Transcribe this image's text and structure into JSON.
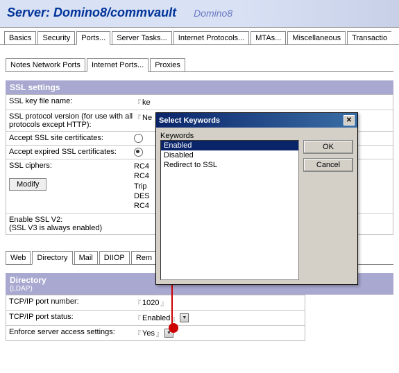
{
  "header": {
    "prefix": "Server: ",
    "title": "Domino8/commvault",
    "sub": "Domino8"
  },
  "tabs": [
    "Basics",
    "Security",
    "Ports...",
    "Server Tasks...",
    "Internet Protocols...",
    "MTAs...",
    "Miscellaneous",
    "Transactio"
  ],
  "subtabs": [
    "Notes Network Ports",
    "Internet Ports...",
    "Proxies"
  ],
  "ssl": {
    "title": "SSL settings",
    "key_label": "SSL key file name:",
    "key_value": "ke",
    "proto_label": "SSL protocol version (for use with all protocols except HTTP):",
    "proto_value": "Ne",
    "site_label": "Accept SSL site certificates:",
    "expired_label": "Accept expired SSL certificates:",
    "ciphers_label": "SSL ciphers:",
    "ciphers_value": "RC4\nRC4\nTrip\nDES\nRC4",
    "modify": "Modify",
    "v2_label": "Enable SSL V2:",
    "v2_sub": "(SSL V3 is always enabled)"
  },
  "proto_tabs": [
    "Web",
    "Directory",
    "Mail",
    "DIIOP",
    "Rem"
  ],
  "directory": {
    "title": "Directory",
    "sub": "(LDAP)",
    "port_label": "TCP/IP port number:",
    "port_value": "1020",
    "status_label": "TCP/IP port status:",
    "status_value": "Enabled",
    "enforce_label": "Enforce server access settings:",
    "enforce_value": "Yes"
  },
  "dialog": {
    "title": "Select Keywords",
    "kwlabel": "Keywords",
    "items": [
      "Enabled",
      "Disabled",
      "Redirect to SSL"
    ],
    "ok": "OK",
    "cancel": "Cancel"
  }
}
